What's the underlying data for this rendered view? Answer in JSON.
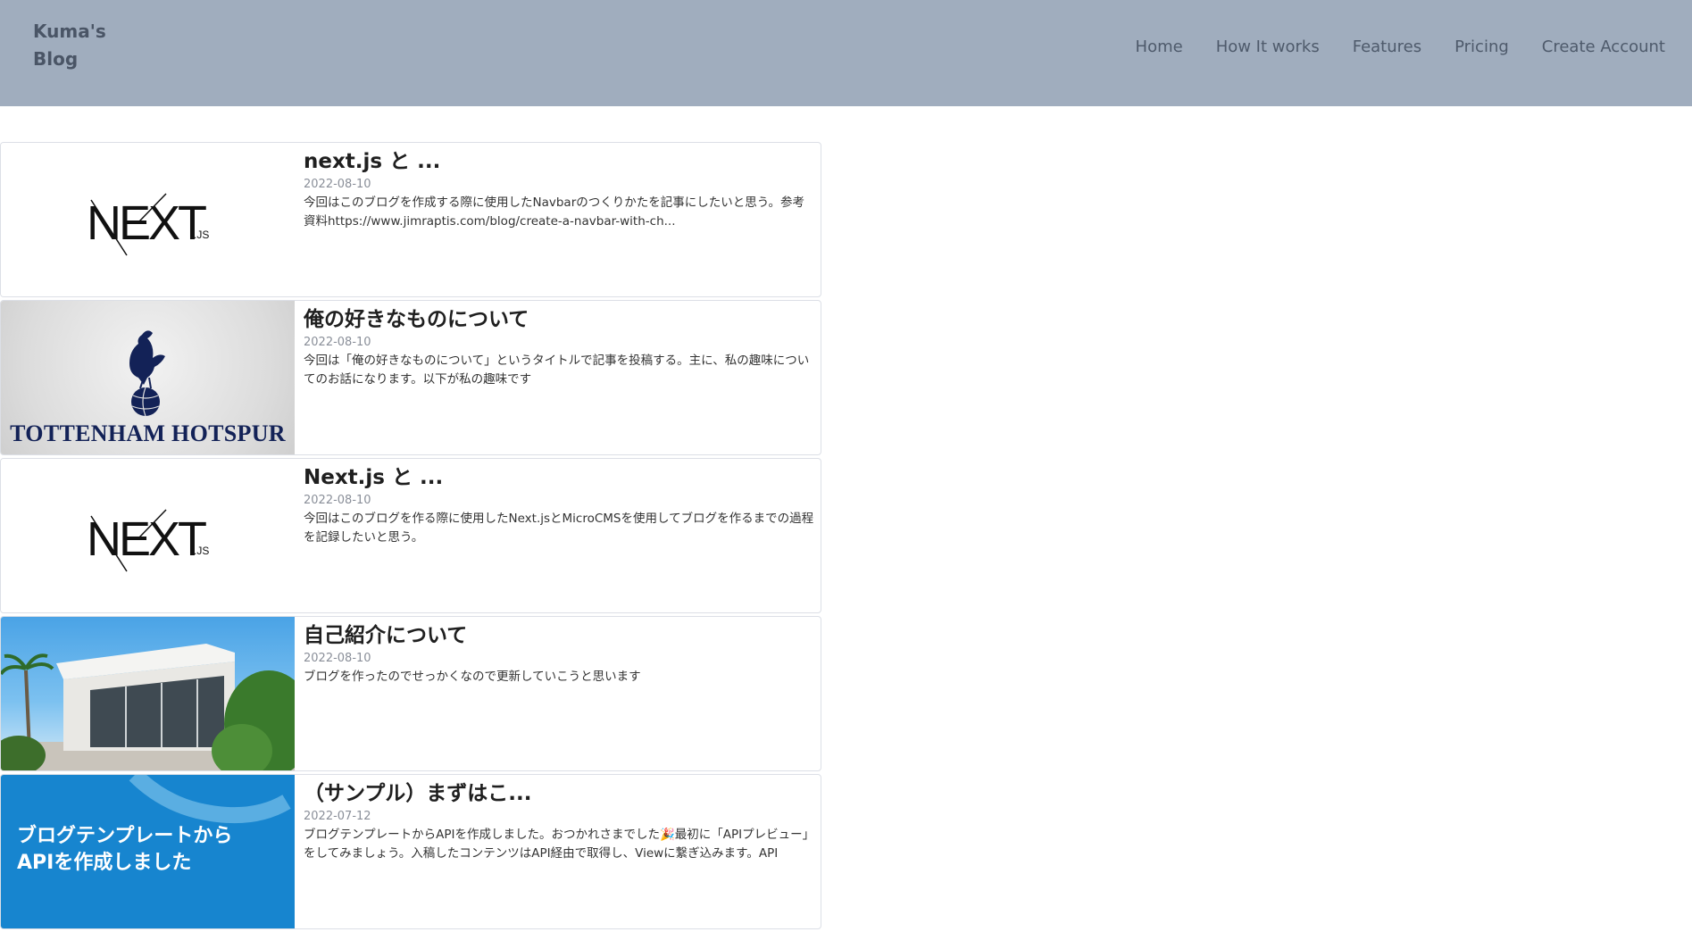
{
  "brand": {
    "line1": "Kuma's",
    "line2": "Blog"
  },
  "nav": [
    {
      "label": "Home"
    },
    {
      "label": "How It works"
    },
    {
      "label": "Features"
    },
    {
      "label": "Pricing"
    },
    {
      "label": "Create Account"
    }
  ],
  "posts": [
    {
      "title": "next.js と ...",
      "date": "2022-08-10",
      "excerpt": "今回はこのブログを作成する際に使用したNavbarのつくりかたを記事にしたいと思う。参考資料https://www.jimraptis.com/blog/create-a-navbar-with-ch...",
      "thumb_logo": "NEXT",
      "thumb_sub": ".JS"
    },
    {
      "title": "俺の好きなものについて",
      "date": "2022-08-10",
      "excerpt": "今回は「俺の好きなものについて」というタイトルで記事を投稿する。主に、私の趣味についてのお話になります。以下が私の趣味です",
      "thumb_text": "TOTTENHAM HOTSPUR"
    },
    {
      "title": "Next.js と ...",
      "date": "2022-08-10",
      "excerpt": "今回はこのブログを作る際に使用したNext.jsとMicroCMSを使用してブログを作るまでの過程を記録したいと思う。",
      "thumb_logo": "NEXT",
      "thumb_sub": ".JS"
    },
    {
      "title": "自己紹介について",
      "date": "2022-08-10",
      "excerpt": "ブログを作ったのでせっかくなので更新していこうと思います"
    },
    {
      "title": "（サンプル）まずはこ...",
      "date": "2022-07-12",
      "excerpt": "ブログテンプレートからAPIを作成しました。おつかれさまでした🎉最初に「APIプレビュー」をしてみましょう。入稿したコンテンツはAPI経由で取得し、Viewに繋ぎ込みます。API",
      "thumb_text_line1": "ブログテンプレートから",
      "thumb_text_line2": "APIを作成しました"
    }
  ],
  "colors": {
    "navbar_bg": "#a0adbe",
    "nav_text": "#4e5a6b",
    "spurs_navy": "#132257",
    "sample_blue": "#1785cf"
  }
}
